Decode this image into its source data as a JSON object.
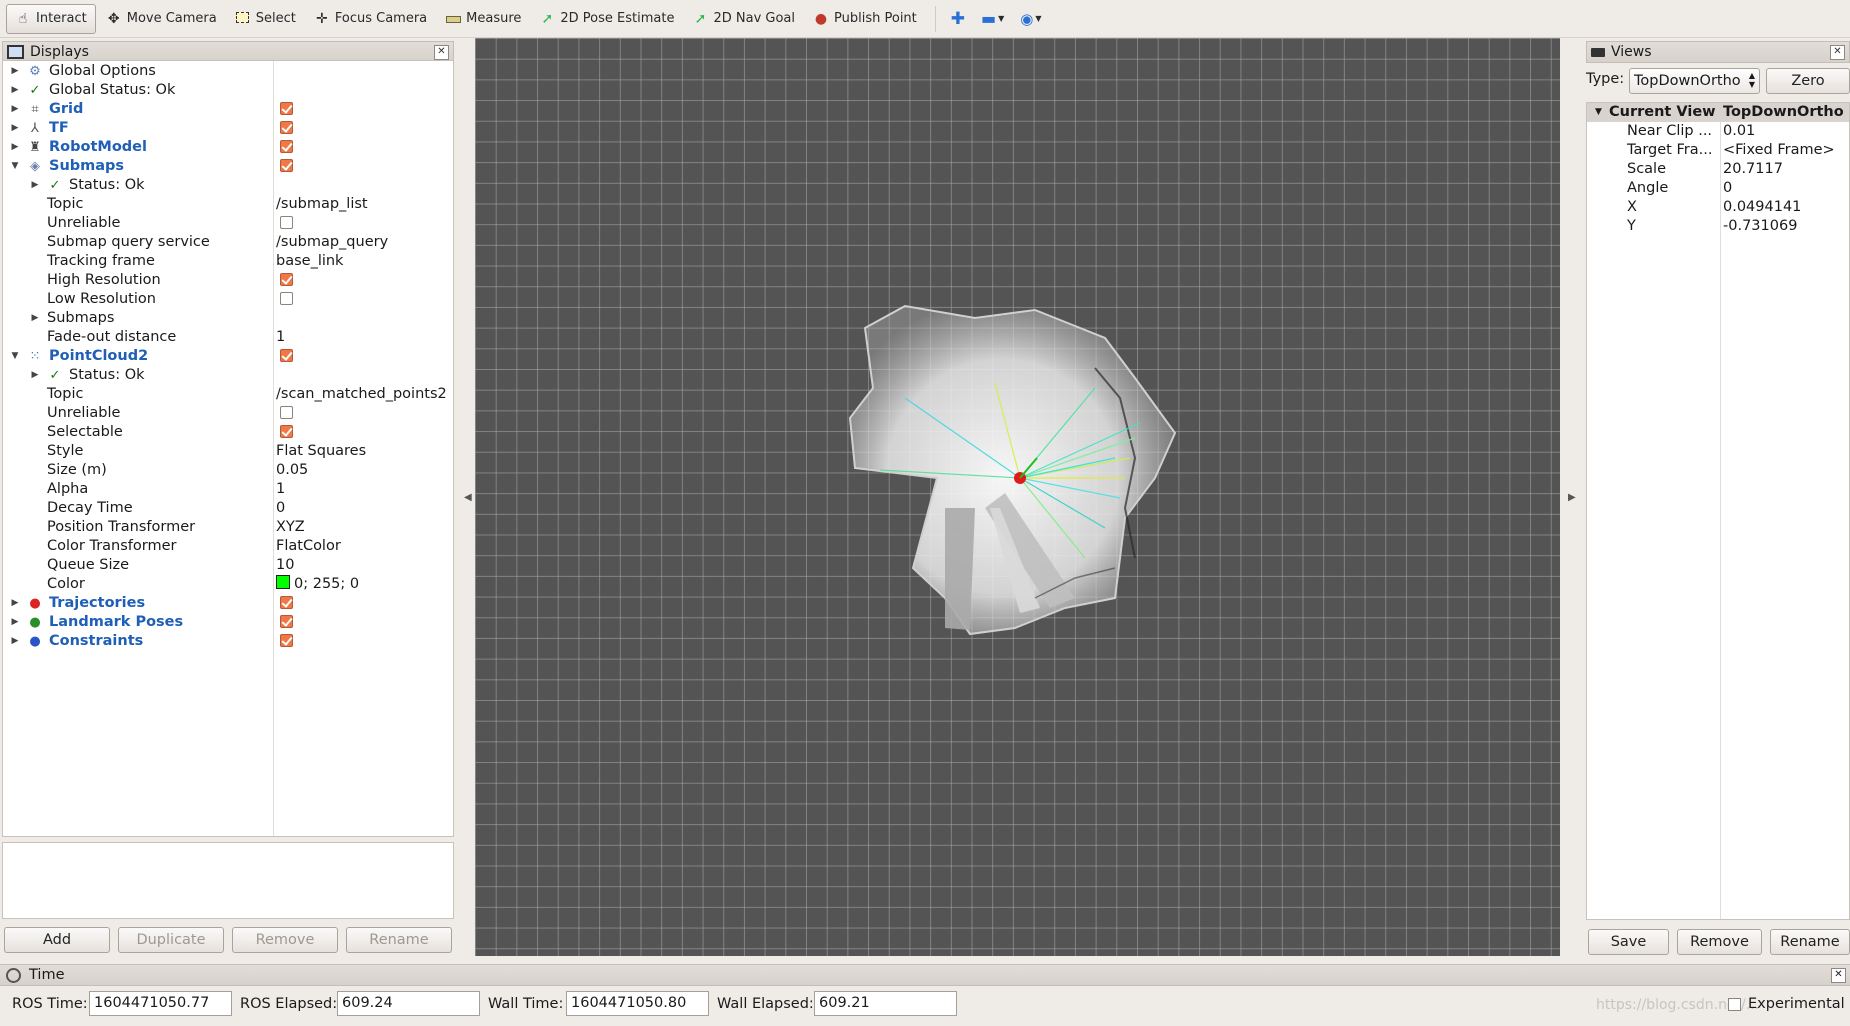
{
  "toolbar": {
    "tools": [
      {
        "label": "Interact",
        "icon": "hand-pointer-icon"
      },
      {
        "label": "Move Camera",
        "icon": "move-camera-icon"
      },
      {
        "label": "Select",
        "icon": "select-box-icon"
      },
      {
        "label": "Focus Camera",
        "icon": "focus-camera-icon"
      },
      {
        "label": "Measure",
        "icon": "ruler-icon"
      },
      {
        "label": "2D Pose Estimate",
        "icon": "green-arrow-icon"
      },
      {
        "label": "2D Nav Goal",
        "icon": "green-arrow-icon"
      },
      {
        "label": "Publish Point",
        "icon": "map-pin-icon"
      }
    ]
  },
  "displays": {
    "title": "Displays",
    "rows": [
      {
        "label": "Global Options"
      },
      {
        "label": "Global Status: Ok"
      },
      {
        "label": "Grid"
      },
      {
        "label": "TF"
      },
      {
        "label": "RobotModel"
      },
      {
        "label": "Submaps"
      },
      {
        "label": "Status: Ok"
      },
      {
        "label": "Topic",
        "value": "/submap_list"
      },
      {
        "label": "Unreliable"
      },
      {
        "label": "Submap query service",
        "value": "/submap_query"
      },
      {
        "label": "Tracking frame",
        "value": "base_link"
      },
      {
        "label": "High Resolution"
      },
      {
        "label": "Low Resolution"
      },
      {
        "label": "Submaps"
      },
      {
        "label": "Fade-out distance",
        "value": "1"
      },
      {
        "label": "PointCloud2"
      },
      {
        "label": "Status: Ok"
      },
      {
        "label": "Topic",
        "value": "/scan_matched_points2"
      },
      {
        "label": "Unreliable"
      },
      {
        "label": "Selectable"
      },
      {
        "label": "Style",
        "value": "Flat Squares"
      },
      {
        "label": "Size (m)",
        "value": "0.05"
      },
      {
        "label": "Alpha",
        "value": "1"
      },
      {
        "label": "Decay Time",
        "value": "0"
      },
      {
        "label": "Position Transformer",
        "value": "XYZ"
      },
      {
        "label": "Color Transformer",
        "value": "FlatColor"
      },
      {
        "label": "Queue Size",
        "value": "10"
      },
      {
        "label": "Color",
        "value": "0; 255; 0"
      },
      {
        "label": "Trajectories"
      },
      {
        "label": "Landmark Poses"
      },
      {
        "label": "Constraints"
      }
    ],
    "buttons": {
      "add": "Add",
      "duplicate": "Duplicate",
      "remove": "Remove",
      "rename": "Rename"
    }
  },
  "views": {
    "title": "Views",
    "type_label": "Type:",
    "type_value": "TopDownOrtho",
    "zero_button": "Zero",
    "header": {
      "label": "Current View",
      "value": "TopDownOrtho ..."
    },
    "rows": [
      {
        "label": "Near Clip ...",
        "value": "0.01"
      },
      {
        "label": "Target Fra...",
        "value": "<Fixed Frame>"
      },
      {
        "label": "Scale",
        "value": "20.7117"
      },
      {
        "label": "Angle",
        "value": "0"
      },
      {
        "label": "X",
        "value": "0.0494141"
      },
      {
        "label": "Y",
        "value": "-0.731069"
      }
    ],
    "buttons": {
      "save": "Save",
      "remove": "Remove",
      "rename": "Rename"
    }
  },
  "time": {
    "title": "Time",
    "ros_time_label": "ROS Time:",
    "ros_time": "1604471050.77",
    "ros_elapsed_label": "ROS Elapsed:",
    "ros_elapsed": "609.24",
    "wall_time_label": "Wall Time:",
    "wall_time": "1604471050.80",
    "wall_elapsed_label": "Wall Elapsed:",
    "wall_elapsed": "609.21",
    "experimental_label": "Experimental",
    "watermark": "https://blog.csdn.net/..."
  },
  "colors": {
    "accent_link": "#1f5fb8",
    "checkbox_on": "#f07746",
    "viewport_bg": "#545454",
    "pointcloud": "#00ff00"
  }
}
